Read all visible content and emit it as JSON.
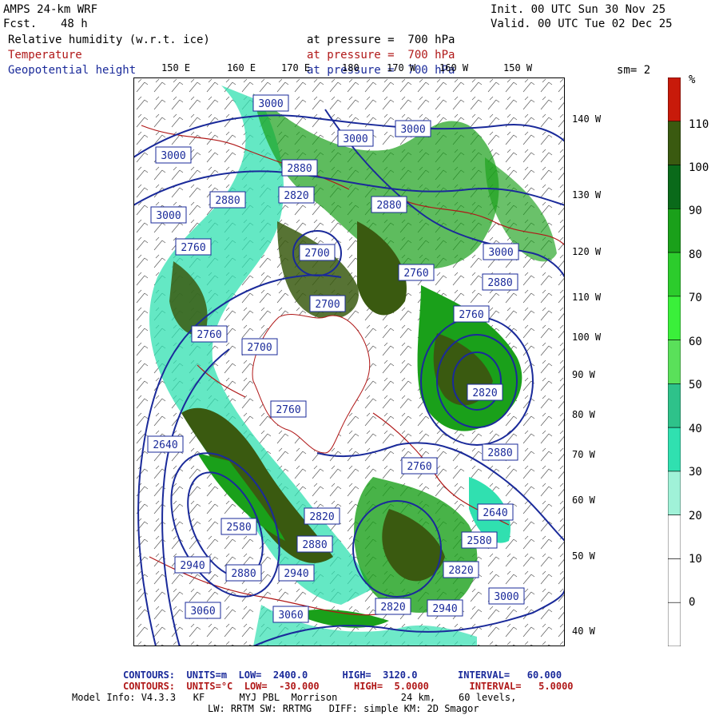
{
  "header": {
    "model": "AMPS 24-km WRF",
    "fcst_label": "Fcst.",
    "fcst_value": "48 h",
    "init": "Init. 00 UTC Sun 30 Nov 25",
    "valid": "Valid. 00 UTC Tue 02 Dec 25",
    "sm": "sm= 2"
  },
  "fields": [
    {
      "name": "Relative humidity (w.r.t. ice)",
      "level": "at pressure =  700 hPa",
      "color": "#000000"
    },
    {
      "name": "Temperature",
      "level": "at pressure =  700 hPa",
      "color": "#b01818"
    },
    {
      "name": "Geopotential height",
      "level": "at pressure =  700 hPa",
      "color": "#1a2a9a"
    }
  ],
  "top_lon_labels": [
    "150 E",
    "160 E",
    "170 E",
    "180",
    "170 W",
    "160 W",
    "150 W"
  ],
  "right_lon_labels": [
    "140 W",
    "130 W",
    "120 W",
    "110 W",
    "100 W",
    "90 W",
    "80 W",
    "70 W",
    "60 W",
    "50 W",
    "40 W"
  ],
  "colorbar": {
    "unit": "%",
    "labels": [
      "110",
      "100",
      "90",
      "80",
      "70",
      "60",
      "50",
      "40",
      "30",
      "20",
      "10",
      "0"
    ],
    "colors": [
      "#c81a0a",
      "#3a5a10",
      "#0a6a1a",
      "#1aa01a",
      "#2ccc2c",
      "#3af03a",
      "#5ae05a",
      "#2ec28a",
      "#30e0b0",
      "#a0f2d8",
      "#ffffff",
      "#ffffff",
      "#ffffff",
      "#ffffff",
      "#ffffff"
    ]
  },
  "height_labels": [
    "3000",
    "3000",
    "3000",
    "3000",
    "2880",
    "2820",
    "2880",
    "2880",
    "2760",
    "2700",
    "2760",
    "2880",
    "3000",
    "2700",
    "2760",
    "2700",
    "2760",
    "2760",
    "2820",
    "2640",
    "2580",
    "2820",
    "2880",
    "2820",
    "2940",
    "2880",
    "2940",
    "3060",
    "3060",
    "3000",
    "2820",
    "2760",
    "2880",
    "2640",
    "2580",
    "2940",
    "3000"
  ],
  "map_colors": {
    "rh_dark": "#3a5a10",
    "rh_green": "#1aa01a",
    "rh_light": "#30e0b0",
    "height": "#1a2a9a",
    "temp": "#b01818",
    "ice": "#ffffff"
  },
  "footer": {
    "contours1": "CONTOURS:  UNITS=m  LOW=  2400.0      HIGH=  3120.0       INTERVAL=   60.000",
    "contours2": "CONTOURS:  UNITS=°C  LOW=  -30.000      HIGH=  5.0000       INTERVAL=   5.0000",
    "model_info": "Model Info: V4.3.3   KF      MYJ PBL  Morrison           24 km,    60 levels,",
    "model_info2": "LW: RRTM SW: RRTMG   DIFF: simple KM: 2D Smagor"
  }
}
